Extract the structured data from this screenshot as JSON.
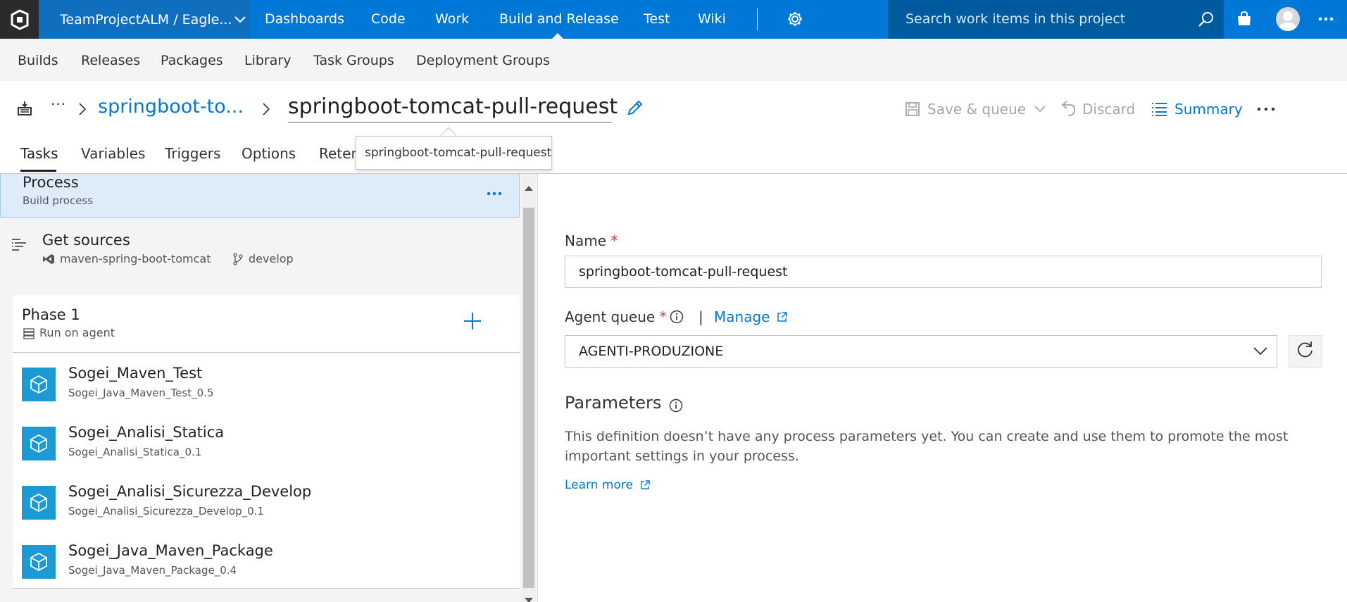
{
  "topnav": {
    "project": "TeamProjectALM / Eagle...",
    "items": [
      "Dashboards",
      "Code",
      "Work",
      "Build and Release",
      "Test",
      "Wiki"
    ],
    "search_placeholder": "Search work items in this project"
  },
  "subnav": {
    "items": [
      "Builds",
      "Releases",
      "Packages",
      "Library",
      "Task Groups",
      "Deployment Groups"
    ]
  },
  "header": {
    "breadcrumb_dots": "···",
    "breadcrumb_link": "springboot-to...",
    "title": "springboot-tomcat-pull-request",
    "actions": {
      "save_queue": "Save & queue",
      "discard": "Discard",
      "summary": "Summary"
    }
  },
  "tabs": [
    "Tasks",
    "Variables",
    "Triggers",
    "Options",
    "Reten"
  ],
  "tooltip": "springboot-tomcat-pull-request",
  "process": {
    "title": "Process",
    "subtitle": "Build process"
  },
  "get_sources": {
    "title": "Get sources",
    "repo": "maven-spring-boot-tomcat",
    "branch": "develop"
  },
  "phase": {
    "title": "Phase 1",
    "subtitle": "Run on agent"
  },
  "tasks": [
    {
      "name": "Sogei_Maven_Test",
      "version": "Sogei_Java_Maven_Test_0.5"
    },
    {
      "name": "Sogei_Analisi_Statica",
      "version": "Sogei_Analisi_Statica_0.1"
    },
    {
      "name": "Sogei_Analisi_Sicurezza_Develop",
      "version": "Sogei_Analisi_Sicurezza_Develop_0.1"
    },
    {
      "name": "Sogei_Java_Maven_Package",
      "version": "Sogei_Java_Maven_Package_0.4"
    }
  ],
  "details": {
    "name_label": "Name",
    "required_mark": "*",
    "name_value": "springboot-tomcat-pull-request",
    "agent_queue_label": "Agent queue",
    "pipe": "|",
    "manage_label": "Manage",
    "agent_queue_value": "AGENTI-PRODUZIONE",
    "parameters_heading": "Parameters",
    "parameters_text": "This definition doesn’t have any process parameters yet. You can create and use them to promote the most important settings in your process.",
    "learn_more": "Learn more"
  },
  "colors": {
    "accent": "#0078d7",
    "topbar": "#0078d7",
    "selected_row": "#deecf9",
    "task_icon": "#1c9ad6",
    "required": "#d13438"
  }
}
